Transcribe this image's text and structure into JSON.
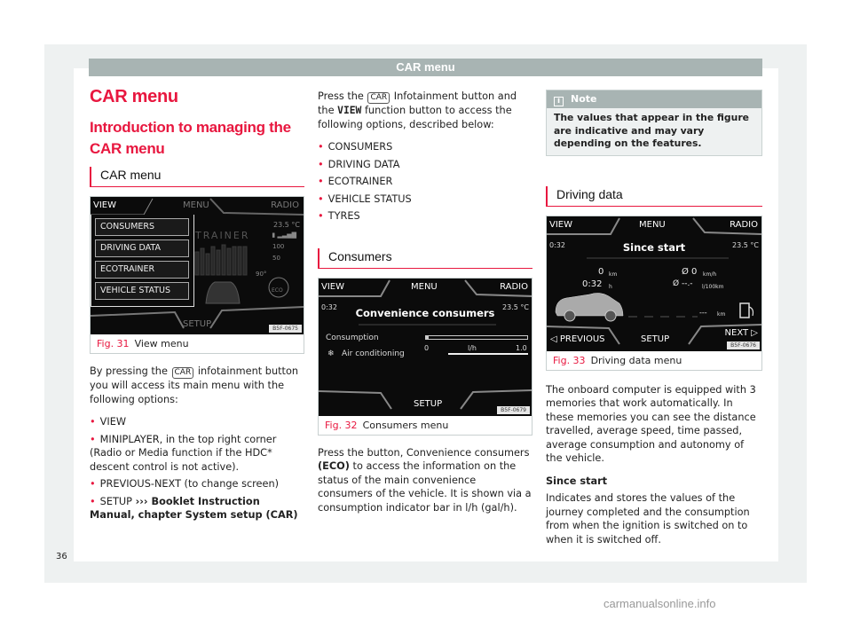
{
  "page_header": "CAR menu",
  "page_number": "36",
  "watermark": "carmanualsonline.info",
  "col1": {
    "title": "CAR menu",
    "subtitle": "Introduction to managing the CAR menu",
    "section": "CAR menu",
    "figure": {
      "screen": {
        "tab_left": "VIEW",
        "tab_center": "MENU",
        "tab_right": "RADIO",
        "menu_items": [
          "CONSUMERS",
          "DRIVING DATA",
          "ECOTRAINER",
          "VEHICLE STATUS"
        ],
        "bg_label": "TRAINER",
        "temperature": "23.5 °C",
        "scale_100": "100",
        "scale_50": "50",
        "angle": "90°",
        "eco_badge": "ECO",
        "bottom": "SETUP",
        "code": "B5F-0675"
      },
      "number": "Fig. 31",
      "caption": "View menu"
    },
    "intro_before": "By pressing the",
    "kbd": "CAR",
    "intro_after": "infotainment button you will access its main menu with the following options:",
    "bullets": [
      "VIEW",
      "MINIPLAYER, in the top right corner (Radio or Media function if the HDC* descent control is not active).",
      "PREVIOUS-NEXT (to change screen)"
    ],
    "setup_bullet": "SETUP",
    "setup_ref": "››› Booklet Instruction Manual, chapter System setup (CAR)"
  },
  "col2": {
    "intro_before": "Press the",
    "kbd": "CAR",
    "intro_mid": "Infotainment button and the",
    "view_word": "VIEW",
    "intro_after": "function button to access the following options, described below:",
    "bullets": [
      "CONSUMERS",
      "DRIVING DATA",
      "ECOTRAINER",
      "VEHICLE STATUS",
      "TYRES"
    ],
    "section": "Consumers",
    "figure": {
      "screen": {
        "tab_left": "VIEW",
        "tab_center": "MENU",
        "tab_right": "RADIO",
        "time": "0:32",
        "temperature": "23.5 °C",
        "title": "Convenience consumers",
        "consumption_label": "Consumption",
        "scale_min": "0",
        "scale_unit": "l/h",
        "scale_max": "1.0",
        "consumer_icon": "snowflake",
        "consumer_label": "Air conditioning",
        "bottom": "SETUP",
        "code": "B5F-0679"
      },
      "number": "Fig. 32",
      "caption": "Consumers menu"
    },
    "para_before": "Press the button, Convenience consumers",
    "eco": "(ECO)",
    "para_after": "to access the information on the status of the main convenience consumers of the vehicle. It is shown via a consumption indicator bar in l/h (gal/h)."
  },
  "col3": {
    "note_title": "Note",
    "note_text": "The values that appear in the figure are indicative and may vary depending on the features.",
    "section": "Driving data",
    "figure": {
      "screen": {
        "tab_left": "VIEW",
        "tab_center": "MENU",
        "tab_right": "RADIO",
        "time": "0:32",
        "temperature": "23.5 °C",
        "title": "Since start",
        "distance": "0",
        "distance_unit": "km",
        "duration": "0:32",
        "duration_unit": "h",
        "avg_speed": "Ø 0",
        "avg_speed_unit": "km/h",
        "avg_cons": "Ø --.-",
        "avg_cons_unit": "l/100km",
        "range": "---",
        "range_unit": "km",
        "prev": "◁ PREVIOUS",
        "bottom": "SETUP",
        "next": "NEXT ▷",
        "code": "B5F-0676"
      },
      "number": "Fig. 33",
      "caption": "Driving data menu"
    },
    "para1": "The onboard computer is equipped with 3 memories that work automatically. In these memories you can see the distance travelled, average speed, time passed, average consumption and autonomy of the vehicle.",
    "subheading": "Since start",
    "para2": "Indicates and stores the values of the journey completed and the consumption from when the ignition is switched on to when it is switched off."
  }
}
